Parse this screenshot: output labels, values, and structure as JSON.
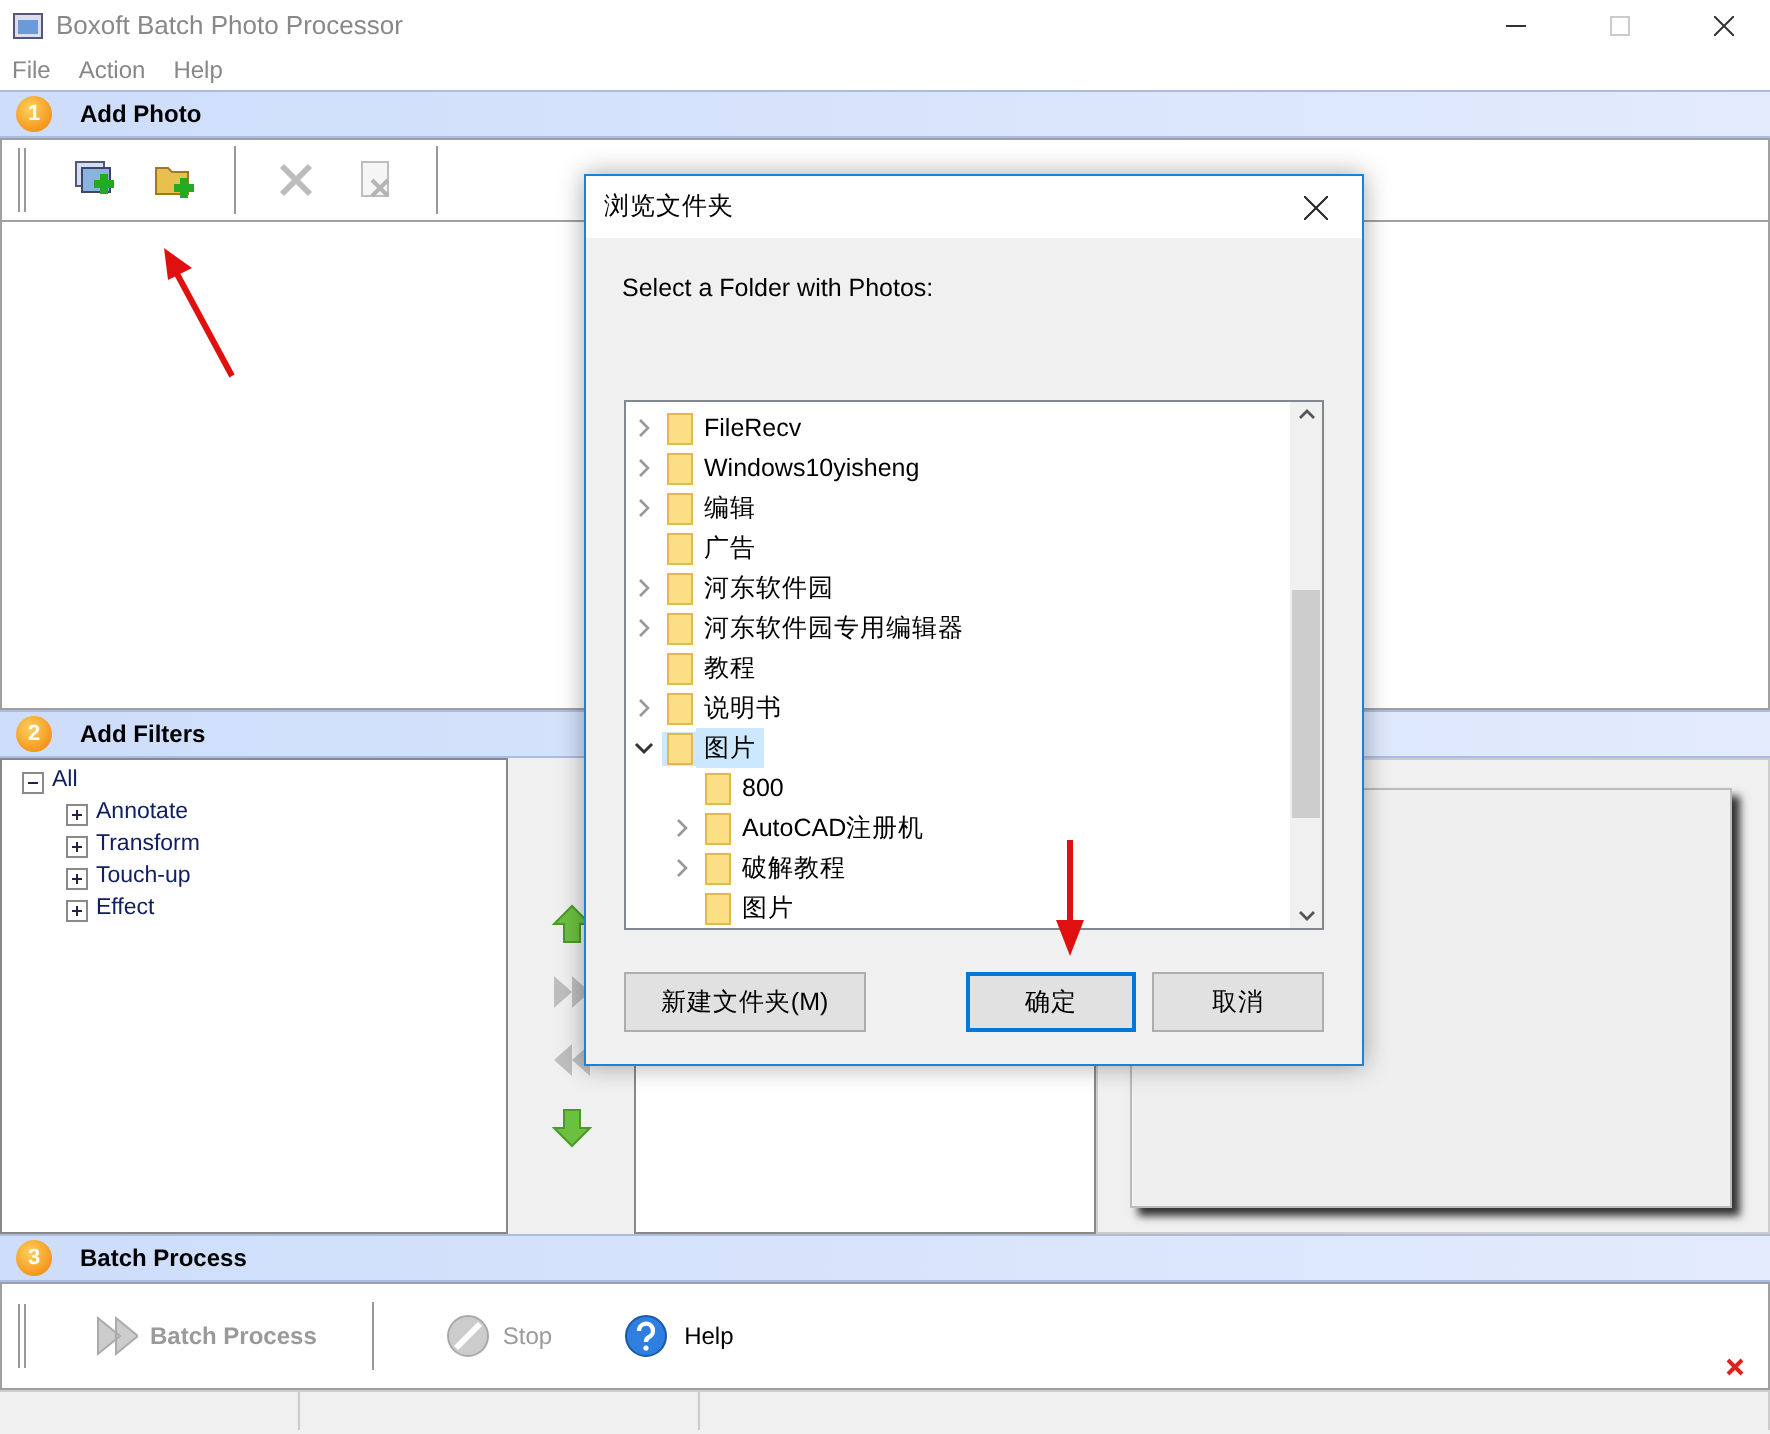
{
  "window": {
    "title": "Boxoft Batch Photo Processor"
  },
  "menu": [
    "File",
    "Action",
    "Help"
  ],
  "sections": [
    {
      "number": "1",
      "title": "Add Photo"
    },
    {
      "number": "2",
      "title": "Add Filters"
    },
    {
      "number": "3",
      "title": "Batch Process"
    }
  ],
  "photo_toolbar": [
    {
      "kind": "add-image",
      "disabled": false
    },
    {
      "kind": "add-folder",
      "disabled": false
    },
    {
      "kind": "delete",
      "disabled": true
    },
    {
      "kind": "clear",
      "disabled": true
    }
  ],
  "filter_tree": [
    {
      "label": "All",
      "expanded": true,
      "children": [
        {
          "label": "Annotate",
          "expanded": false
        },
        {
          "label": "Transform",
          "expanded": false
        },
        {
          "label": "Touch-up",
          "expanded": false
        },
        {
          "label": "Effect",
          "expanded": false
        }
      ]
    }
  ],
  "filter_buttons": [
    {
      "kind": "up",
      "disabled": false
    },
    {
      "kind": "add",
      "disabled": true
    },
    {
      "kind": "remove",
      "disabled": true
    },
    {
      "kind": "down",
      "disabled": false
    }
  ],
  "batch_toolbar": [
    {
      "kind": "batch",
      "label": "Batch Process",
      "disabled": true
    },
    {
      "kind": "stop",
      "label": "Stop",
      "disabled": true
    },
    {
      "kind": "help",
      "label": "Help",
      "disabled": false
    }
  ],
  "dialog": {
    "title": "浏览文件夹",
    "prompt": "Select a Folder with Photos:",
    "folders": [
      {
        "label": "FileRecv",
        "has_children": true,
        "expanded": false,
        "selected": false
      },
      {
        "label": "Windows10yisheng",
        "has_children": true,
        "expanded": false,
        "selected": false
      },
      {
        "label": "编辑",
        "has_children": true,
        "expanded": false,
        "selected": false
      },
      {
        "label": "广告",
        "has_children": false,
        "expanded": false,
        "selected": false
      },
      {
        "label": "河东软件园",
        "has_children": true,
        "expanded": false,
        "selected": false
      },
      {
        "label": "河东软件园专用编辑器",
        "has_children": true,
        "expanded": false,
        "selected": false
      },
      {
        "label": "教程",
        "has_children": false,
        "expanded": false,
        "selected": false
      },
      {
        "label": "说明书",
        "has_children": true,
        "expanded": false,
        "selected": false
      },
      {
        "label": "图片",
        "has_children": true,
        "expanded": true,
        "selected": true,
        "children": [
          {
            "label": "800",
            "has_children": false,
            "expanded": false,
            "selected": false
          },
          {
            "label": "AutoCAD注册机",
            "has_children": true,
            "expanded": false,
            "selected": false
          },
          {
            "label": "破解教程",
            "has_children": true,
            "expanded": false,
            "selected": false
          },
          {
            "label": "图片",
            "has_children": false,
            "expanded": false,
            "selected": false
          }
        ]
      }
    ],
    "buttons": [
      {
        "label": "新建文件夹(M)",
        "default": false
      },
      {
        "label": "确定",
        "default": true
      },
      {
        "label": "取消",
        "default": false
      }
    ]
  }
}
